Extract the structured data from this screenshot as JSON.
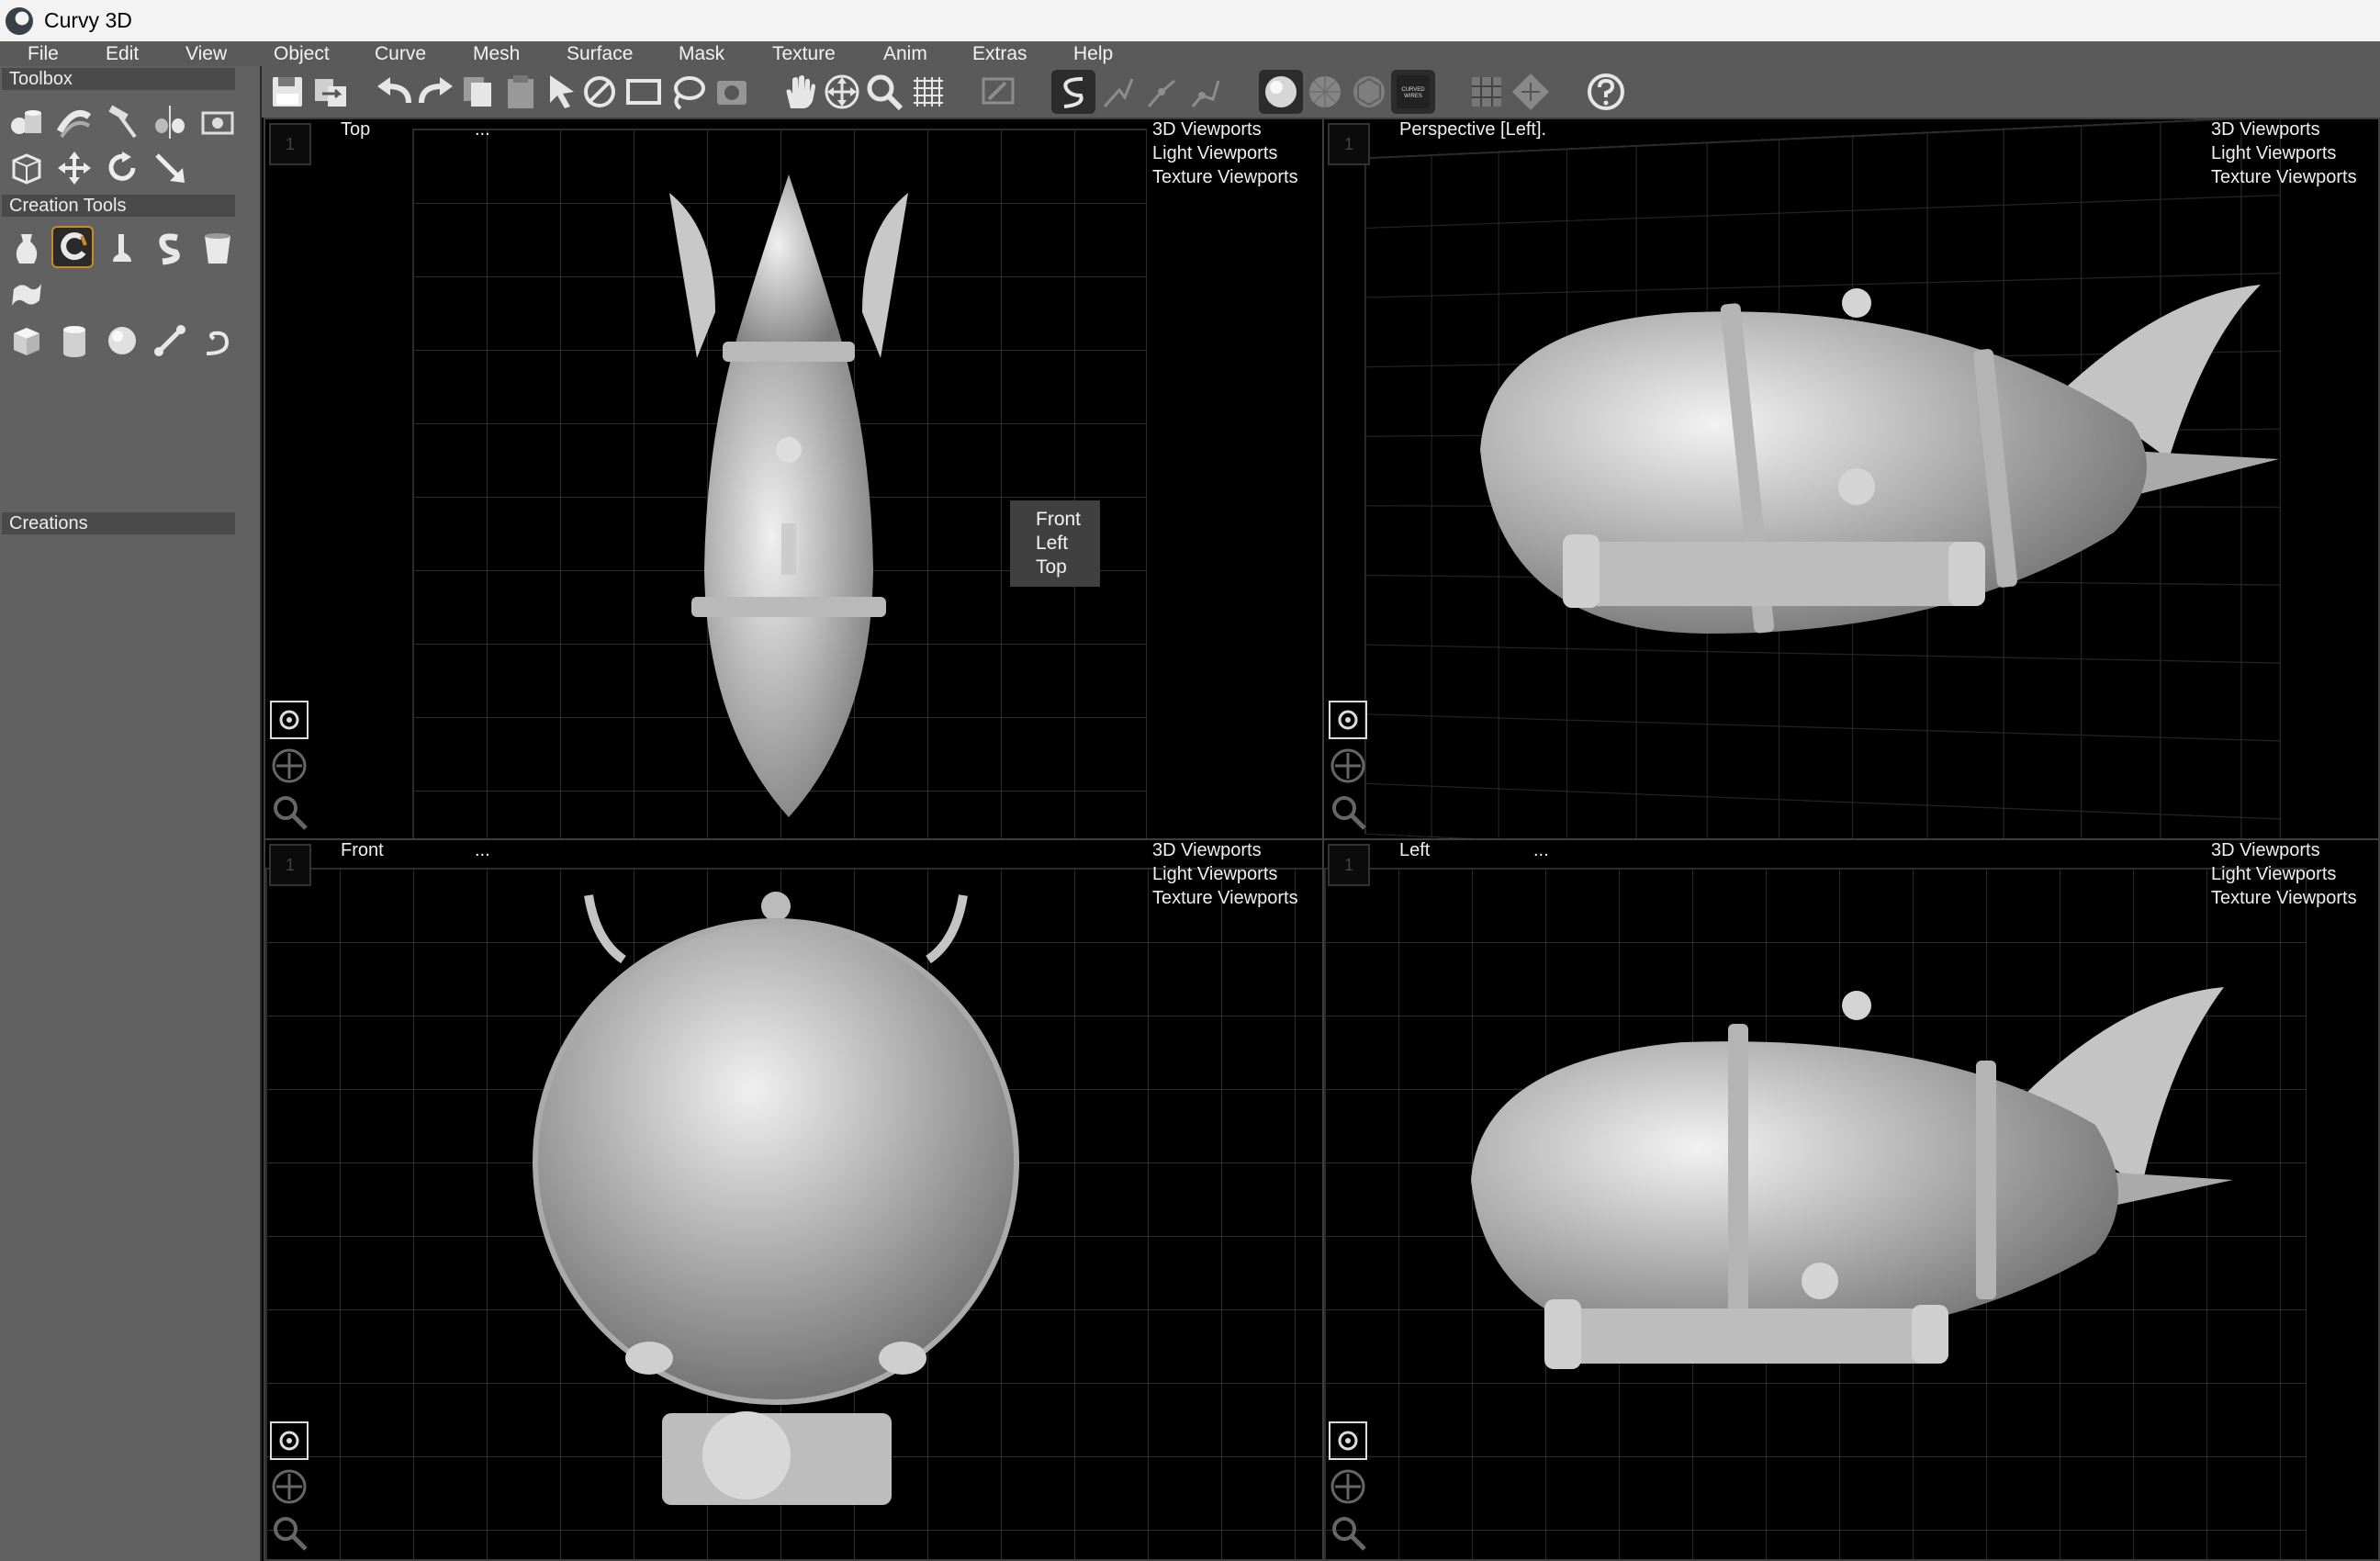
{
  "window": {
    "title": "Curvy 3D"
  },
  "menu": [
    "File",
    "Edit",
    "View",
    "Object",
    "Curve",
    "Mesh",
    "Surface",
    "Mask",
    "Texture",
    "Anim",
    "Extras",
    "Help"
  ],
  "sidebar": {
    "toolbox_label": "Toolbox",
    "creation_tools_label": "Creation Tools",
    "creations_label": "Creations",
    "toolbox_icons": [
      "objects-icon",
      "bend-icon",
      "hammer-icon",
      "mirror-icon",
      "image-icon",
      "cube-frame-icon",
      "move-icon",
      "rotate-icon",
      "scale-icon"
    ],
    "creation_icons": [
      "vase-icon",
      "lathe-icon",
      "extrude-icon",
      "sweep-icon",
      "cup-icon",
      "sheet-icon",
      "cube-icon",
      "cylinder-icon",
      "sphere-icon",
      "bone-icon",
      "tube-icon"
    ]
  },
  "toolbar": {
    "icons": [
      "save-icon",
      "import-icon",
      "undo-icon",
      "redo-icon",
      "copy-icon",
      "paste-icon",
      "select-icon",
      "deselect-icon",
      "rect-select-icon",
      "lasso-icon",
      "camera-icon",
      "pan-hand-icon",
      "move-view-icon",
      "zoom-icon",
      "grid-icon",
      "paint-icon",
      "curve-icon",
      "curve-edit-icon",
      "curve-add-icon",
      "curve-remove-icon",
      "shaded-sphere-icon",
      "wire-sphere-icon",
      "hex-wire-icon",
      "curved-wires-icon",
      "grid-view-icon",
      "diamond-view-icon",
      "help-icon"
    ],
    "curved_wires_label": "CURVED WIRES"
  },
  "viewports": [
    {
      "name": "Top",
      "dots": "...",
      "links": [
        "3D Viewports",
        "Light Viewports",
        "Texture Viewports"
      ],
      "link_more": ".."
    },
    {
      "name": "Perspective [Left].",
      "dots": "",
      "links": [
        "3D Viewports",
        "Light Viewports",
        "Texture Viewports"
      ],
      "link_more": ".."
    },
    {
      "name": "Front",
      "dots": "...",
      "links": [
        "3D Viewports",
        "Light Viewports",
        "Texture Viewports"
      ],
      "link_more": ".."
    },
    {
      "name": "Left",
      "dots": "...",
      "links": [
        "3D Viewports",
        "Light Viewports",
        "Texture Viewports"
      ],
      "link_more": ".."
    }
  ],
  "view_popup": {
    "items": [
      "Front",
      "Left",
      "Top"
    ]
  },
  "colors": {
    "accent": "#c98a28",
    "panel": "#616161",
    "toolbar": "#5a5a5a",
    "viewport_bg": "#000000"
  }
}
